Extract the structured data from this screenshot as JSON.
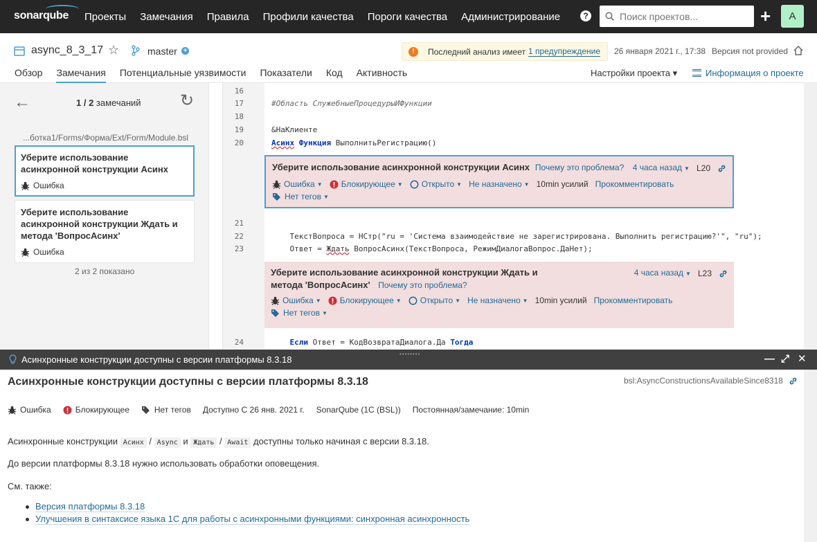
{
  "topnav": {
    "logo": "sonarqube",
    "links": [
      "Проекты",
      "Замечания",
      "Правила",
      "Профили качества",
      "Пороги качества",
      "Администрирование"
    ],
    "help_label": "?",
    "search_placeholder": "Поиск проектов...",
    "create_label": "+",
    "avatar_letter": "A",
    "avatar_color": "#b0f0c8",
    "bg_color": "#262626"
  },
  "project": {
    "name": "async_8_3_17",
    "branch": "master",
    "warning_text": "Последний анализ имеет",
    "warning_link": "1 предупреждение",
    "analysis_date": "26 января 2021 г., 17:38",
    "version": "Версия not provided",
    "tabs": [
      "Обзор",
      "Замечания",
      "Потенциальные уязвимости",
      "Показатели",
      "Код",
      "Активность"
    ],
    "active_tab": "Замечания",
    "settings_label": "Настройки проекта ▾",
    "info_label": "Информация о проекте"
  },
  "sidebar": {
    "counter_current": "1 / 2",
    "counter_label": "замечаний",
    "file_path": "...ботка1/Forms/Форма/Ext/Form/Module.bsl",
    "issues": [
      {
        "title": "Уберите использование асинхронной конструкции Асинх",
        "type": "Ошибка"
      },
      {
        "title": "Уберите использование асинхронной конструкции Ждать и метода 'ВопросАсинх'",
        "type": "Ошибка"
      }
    ],
    "shown_label": "2 из 2 показано"
  },
  "code": {
    "lines": [
      {
        "n": "16",
        "text": ""
      },
      {
        "n": "17",
        "text": "#Область СлужебныеПроцедурыИФункции"
      },
      {
        "n": "18",
        "text": ""
      },
      {
        "n": "19",
        "text": "&НаКлиенте"
      },
      {
        "n": "20",
        "kw1": "Асинх",
        "kw2": "Функция",
        "text": "ВыполнитьРегистрацию()"
      },
      {
        "n": "21",
        "text": ""
      },
      {
        "n": "22",
        "text": "    ТекстВопроса = НСтр(\"ru = 'Система взаимодействие не зарегистрирована. Выполнить регистрацию?'\", \"ru\");"
      },
      {
        "n": "23",
        "pre": "    Ответ = ",
        "sq": "Ждать",
        "text": " ВопросАсинх(ТекстВопроса, РежимДиалогаВопрос.ДаНет);"
      },
      {
        "n": "24",
        "kw1": "Если",
        "text": " Ответ = КодВозвратаДиалога.Да ",
        "kw2": "Тогда"
      }
    ],
    "issues": [
      {
        "message": "Уберите использование асинхронной конструкции Асинх",
        "why": "Почему это проблема?",
        "ago": "4 часа назад",
        "line": "L20",
        "type": "Ошибка",
        "severity": "Блокирующее",
        "status": "Открыто",
        "assignee": "Не назначено",
        "effort": "10min усилий",
        "comment": "Прокомментировать",
        "tags": "Нет тегов"
      },
      {
        "message": "Уберите использование асинхронной конструкции Ждать и метода 'ВопросАсинх'",
        "why": "Почему это проблема?",
        "ago": "4 часа назад",
        "line": "L23",
        "type": "Ошибка",
        "severity": "Блокирующее",
        "status": "Открыто",
        "assignee": "Не назначено",
        "effort": "10min усилий",
        "comment": "Прокомментировать",
        "tags": "Нет тегов"
      }
    ]
  },
  "rule": {
    "bar_title": "Асинхронные конструкции доступны с версии платформы 8.3.18",
    "title": "Асинхронные конструкции доступны с версии платформы 8.3.18",
    "key": "bsl:AsyncConstructionsAvailableSince8318",
    "meta": {
      "type": "Ошибка",
      "severity": "Блокирующее",
      "tags": "Нет тегов",
      "available": "Доступно С 26 янв. 2021 г.",
      "repo": "SonarQube (1C (BSL))",
      "effort": "Постоянная/замечание: 10min"
    },
    "p1": {
      "a": "Асинхронные конструкции",
      "c1": "Асинх",
      "sep1": "/",
      "c2": "Async",
      "and": "и",
      "c3": "Ждать",
      "sep2": "/",
      "c4": "Await",
      "b": "доступны только начиная с версии 8.3.18."
    },
    "p2": "До версии платформы 8.3.18 нужно использовать обработки оповещения.",
    "p3": "См. также:",
    "links": [
      "Версия платформы 8.3.18",
      "Улучшения в синтаксисе языка 1С для работы с асинхронными функциями: синхронная асинхронность"
    ]
  }
}
